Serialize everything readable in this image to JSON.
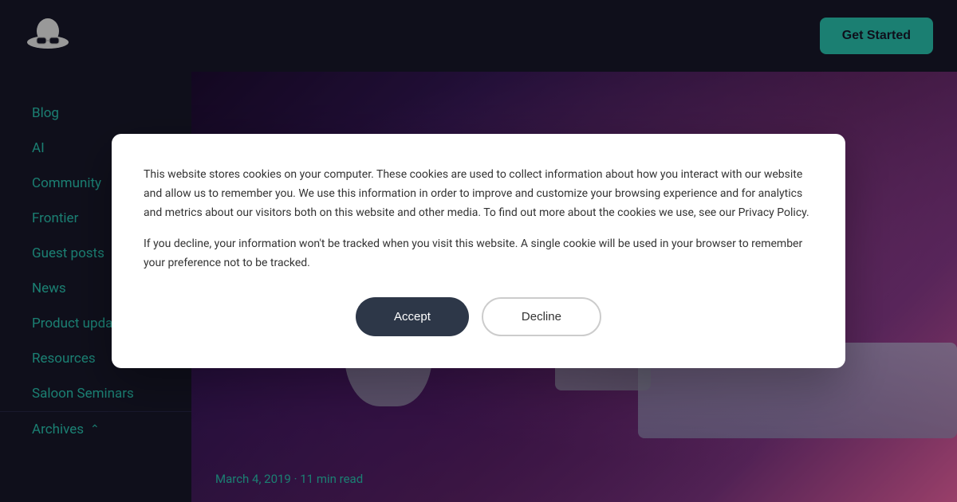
{
  "header": {
    "logo_alt": "Hat with sunglasses logo",
    "get_started_label": "Get Started"
  },
  "sidebar": {
    "nav_items": [
      {
        "label": "Blog",
        "href": "#"
      },
      {
        "label": "AI",
        "href": "#"
      },
      {
        "label": "Community",
        "href": "#"
      },
      {
        "label": "Frontier",
        "href": "#"
      },
      {
        "label": "Guest posts",
        "href": "#"
      },
      {
        "label": "News",
        "href": "#"
      },
      {
        "label": "Product updates",
        "href": "#"
      },
      {
        "label": "Resources",
        "href": "#"
      },
      {
        "label": "Saloon Seminars",
        "href": "#"
      },
      {
        "label": "Archives",
        "href": "#",
        "has_arrow": true
      }
    ]
  },
  "hero": {
    "post_date": "March 4, 2019",
    "read_time": "11 min read",
    "separator": "·"
  },
  "cookie_modal": {
    "paragraph_1": "This website stores cookies on your computer. These cookies are used to collect information about how you interact with our website and allow us to remember you. We use this information in order to improve and customize your browsing experience and for analytics and metrics about our visitors both on this website and other media. To find out more about the cookies we use, see our Privacy Policy.",
    "paragraph_2": "If you decline, your information won't be tracked when you visit this website. A single cookie will be used in your browser to remember your preference not to be tracked.",
    "accept_label": "Accept",
    "decline_label": "Decline"
  },
  "colors": {
    "accent": "#2dd4bf",
    "sidebar_bg": "#1a1a2e",
    "modal_accept_bg": "#2d3748"
  }
}
